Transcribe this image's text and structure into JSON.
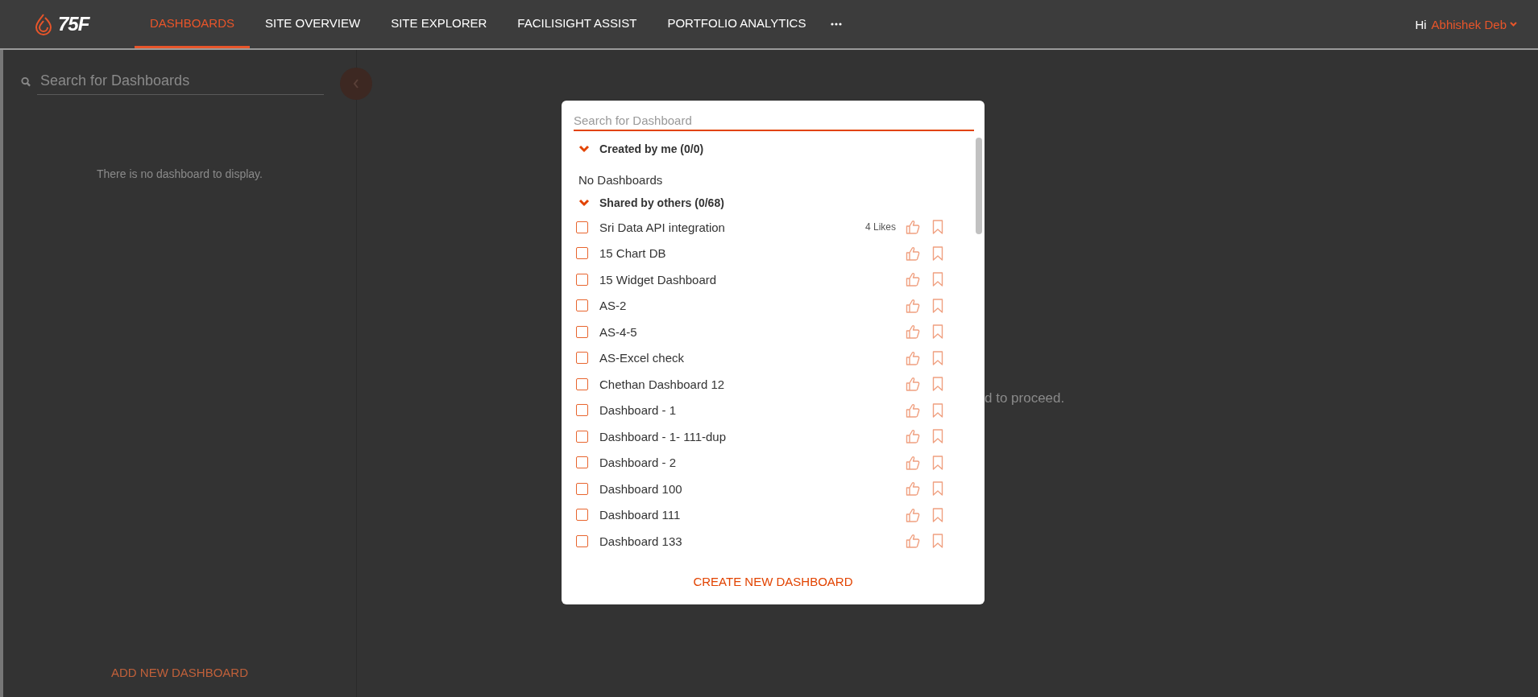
{
  "header": {
    "logo": "75F",
    "tabs": [
      {
        "label": "DASHBOARDS",
        "selected": true
      },
      {
        "label": "SITE OVERVIEW",
        "selected": false
      },
      {
        "label": "SITE EXPLORER",
        "selected": false
      },
      {
        "label": "FACILISIGHT ASSIST",
        "selected": false
      },
      {
        "label": "PORTFOLIO ANALYTICS",
        "selected": false
      }
    ],
    "user": {
      "greeting": "Hi",
      "name": "Abhishek Deb"
    }
  },
  "sidebar": {
    "search": {
      "placeholder": "Search for Dashboards"
    },
    "empty_message": "There is no dashboard to display.",
    "add_button": "ADD NEW DASHBOARD"
  },
  "main": {
    "message": "d to proceed."
  },
  "modal": {
    "search": {
      "placeholder": "Search for Dashboard"
    },
    "sections": [
      {
        "title": "Created by me (0/0)",
        "expanded": true,
        "empty_message": "No Dashboards"
      },
      {
        "title": "Shared by others (0/68)",
        "expanded": true,
        "items": [
          {
            "name": "Sri Data API integration",
            "likes": "4 Likes",
            "checked": false
          },
          {
            "name": "15 Chart DB",
            "checked": false
          },
          {
            "name": "15 Widget Dashboard",
            "checked": false
          },
          {
            "name": "AS-2",
            "checked": false
          },
          {
            "name": "AS-4-5",
            "checked": false
          },
          {
            "name": "AS-Excel check",
            "checked": false
          },
          {
            "name": "Chethan Dashboard 12",
            "checked": false
          },
          {
            "name": "Dashboard - 1",
            "checked": false
          },
          {
            "name": "Dashboard - 1- 111-dup",
            "checked": false
          },
          {
            "name": "Dashboard - 2",
            "checked": false
          },
          {
            "name": "Dashboard 100",
            "checked": false
          },
          {
            "name": "Dashboard 111",
            "checked": false
          },
          {
            "name": "Dashboard 133",
            "checked": false
          }
        ]
      }
    ],
    "create_button": "CREATE NEW DASHBOARD"
  }
}
